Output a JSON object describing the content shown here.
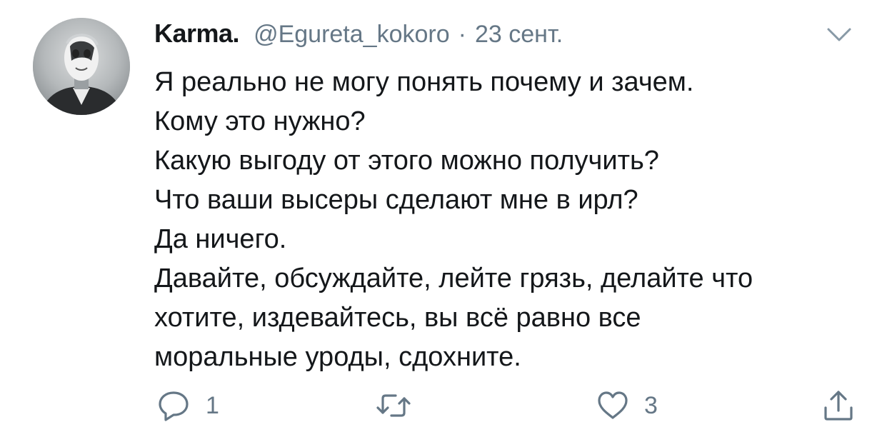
{
  "author": {
    "display_name": "Karma.",
    "handle": "@Egureta_kokoro",
    "separator": "·",
    "date": "23 сент."
  },
  "tweet": {
    "lines": [
      "Я реально не могу понять почему и зачем.",
      "Кому это нужно?",
      "Какую выгоду от этого можно получить?",
      "Что ваши высеры сделают мне в ирл?",
      "Да ничего.",
      "Давайте, обсуждайте, лейте грязь, делайте что",
      "хотите, издевайтесь, вы всё равно все",
      "моральные уроды, сдохните."
    ]
  },
  "actions": {
    "reply_count": "1",
    "like_count": "3"
  },
  "icons": {
    "menu": "chevron-down-icon",
    "reply": "reply-icon",
    "retweet": "retweet-icon",
    "like": "heart-icon",
    "share": "share-icon"
  },
  "colors": {
    "text": "#14171a",
    "secondary": "#657786",
    "background": "#ffffff"
  }
}
